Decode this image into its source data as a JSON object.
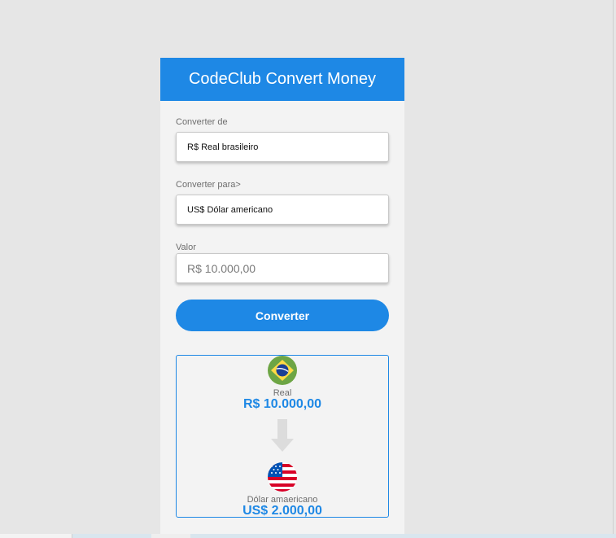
{
  "app": {
    "title": "CodeClub Convert Money"
  },
  "form": {
    "from_label": "Converter de",
    "from_value": "R$ Real brasileiro",
    "to_label": "Converter para>",
    "to_value": "US$ Dólar americano",
    "amount_label": "Valor",
    "amount_placeholder": "R$ 10.000,00",
    "convert_button": "Converter"
  },
  "result": {
    "from_currency_name": "Real",
    "from_currency_value": "R$ 10.000,00",
    "from_flag_icon": "brazil-flag-icon",
    "arrow_icon": "arrow-down-icon",
    "to_currency_name": "Dólar amaericano",
    "to_currency_value": "US$ 2.000,00",
    "to_flag_icon": "usa-flag-icon"
  },
  "colors": {
    "primary": "#1e88e5",
    "page_background": "#e6e6e6",
    "card_background": "#f3f3f3"
  }
}
